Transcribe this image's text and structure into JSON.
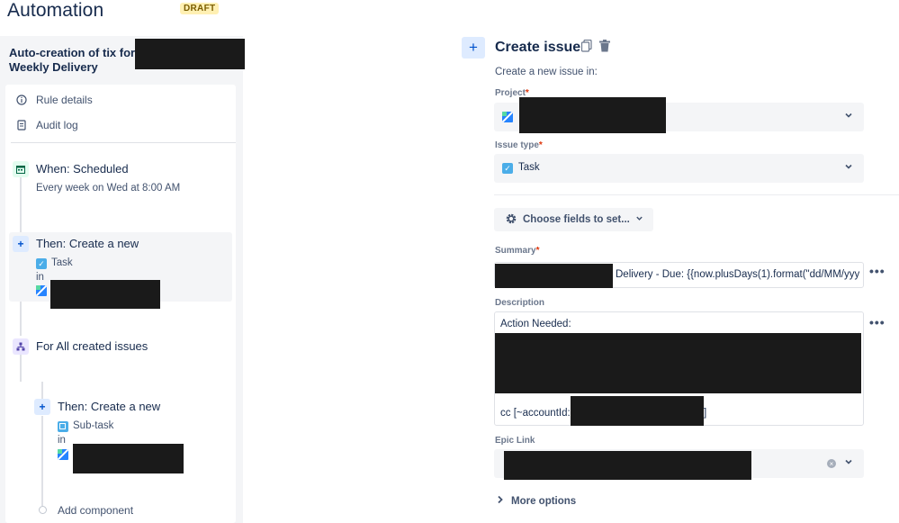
{
  "header": {
    "title": "Automation",
    "badge": "DRAFT"
  },
  "rule": {
    "name": "Auto-creation of tix for Weekly Delivery"
  },
  "menu": {
    "rule_details": "Rule details",
    "audit_log": "Audit log"
  },
  "flow": {
    "trigger_title": "When: Scheduled",
    "trigger_desc": "Every week on Wed at 8:00 AM",
    "action1_title": "Then: Create a new",
    "action1_type": "Task",
    "action1_in": "in",
    "branch_title": "For All created issues",
    "action2_title": "Then: Create a new",
    "action2_type": "Sub-task",
    "action2_in": "in",
    "add_component": "Add component"
  },
  "panel": {
    "title": "Create issue",
    "subtitle": "Create a new issue in:",
    "project_label": "Project",
    "issue_type_label": "Issue type",
    "issue_type_value": "Task",
    "choose_fields": "Choose fields to set...",
    "summary_label": "Summary",
    "summary_value": "Delivery - Due: {{now.plusDays(1).format(\"dd/MM/yyy",
    "description_label": "Description",
    "description_line1": "Action Needed:",
    "description_cc": "cc [~accountId:",
    "description_cc_end": "]",
    "epic_link_label": "Epic Link",
    "more_options": "More options",
    "required_marker": "*",
    "more_glyph": "•••"
  },
  "icons": {
    "add": "plus-icon",
    "copy": "copy-icon",
    "delete": "trash-icon",
    "gear": "gear-icon",
    "chevron": "chevron-down-icon"
  }
}
